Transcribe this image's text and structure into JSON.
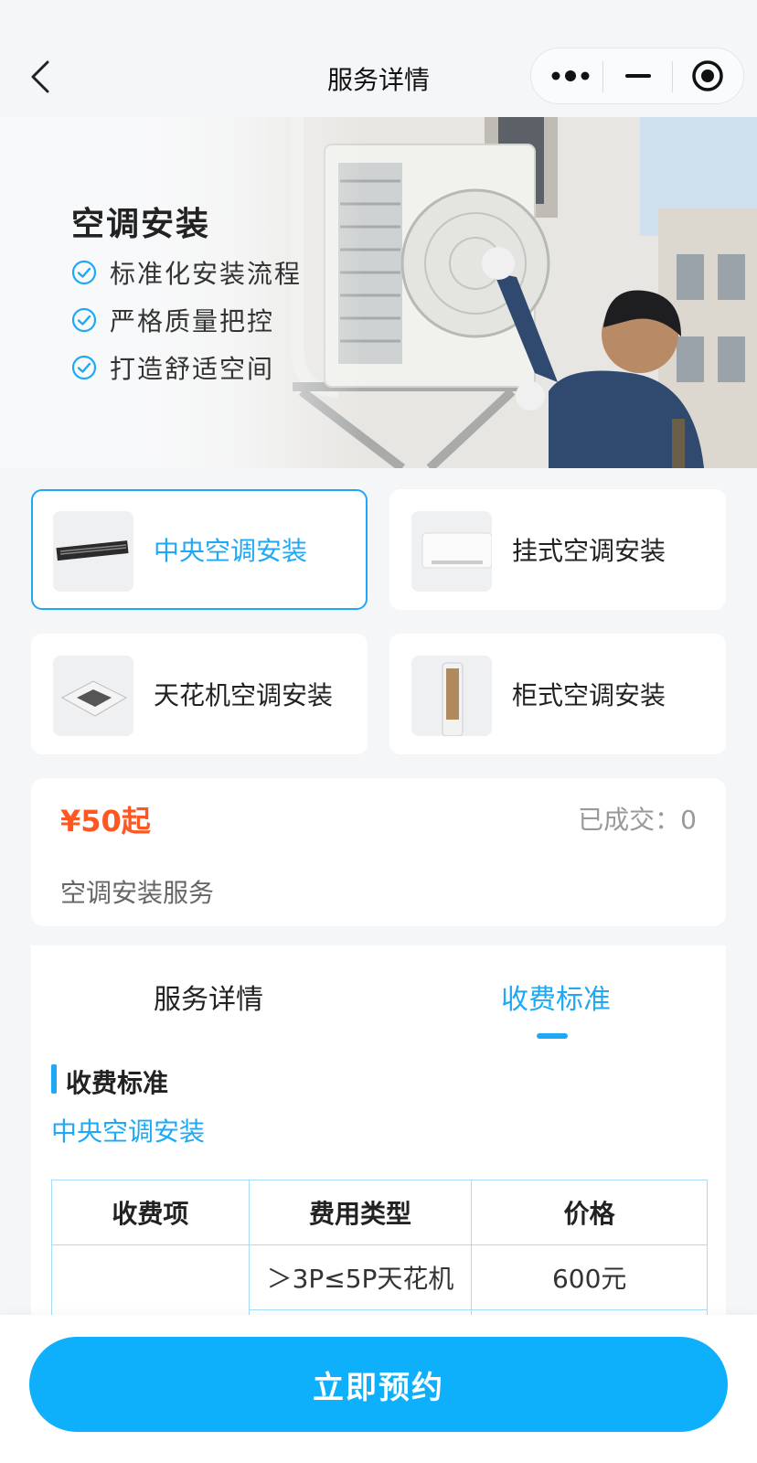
{
  "nav": {
    "title": "服务详情",
    "back_icon": "back-icon",
    "more_icon": "more-dots-icon",
    "minimize_icon": "minimize-icon",
    "close_icon": "target-close-icon"
  },
  "banner": {
    "title": "空调安装",
    "features": [
      "标准化安装流程",
      "严格质量把控",
      "打造舒适空间"
    ]
  },
  "services": [
    {
      "label": "中央空调安装",
      "active": true
    },
    {
      "label": "挂式空调安装",
      "active": false
    },
    {
      "label": "天花机空调安装",
      "active": false
    },
    {
      "label": "柜式空调安装",
      "active": false
    }
  ],
  "price_card": {
    "price": "¥50起",
    "sold": "已成交：0",
    "service_name": "空调安装服务"
  },
  "tabs": {
    "detail": "服务详情",
    "fee": "收费标准",
    "active": "fee"
  },
  "fee_section": {
    "title": "收费标准",
    "subtitle": "中央空调安装",
    "headers": [
      "收费项",
      "费用类型",
      "价格"
    ],
    "rows": [
      {
        "item": "",
        "type": "＞3P≤5P天花机",
        "price": "600元"
      }
    ]
  },
  "cta": {
    "label": "立即预约"
  },
  "colors": {
    "accent": "#1fa8f5",
    "price": "#ff5722",
    "cta": "#0fb0fb"
  }
}
